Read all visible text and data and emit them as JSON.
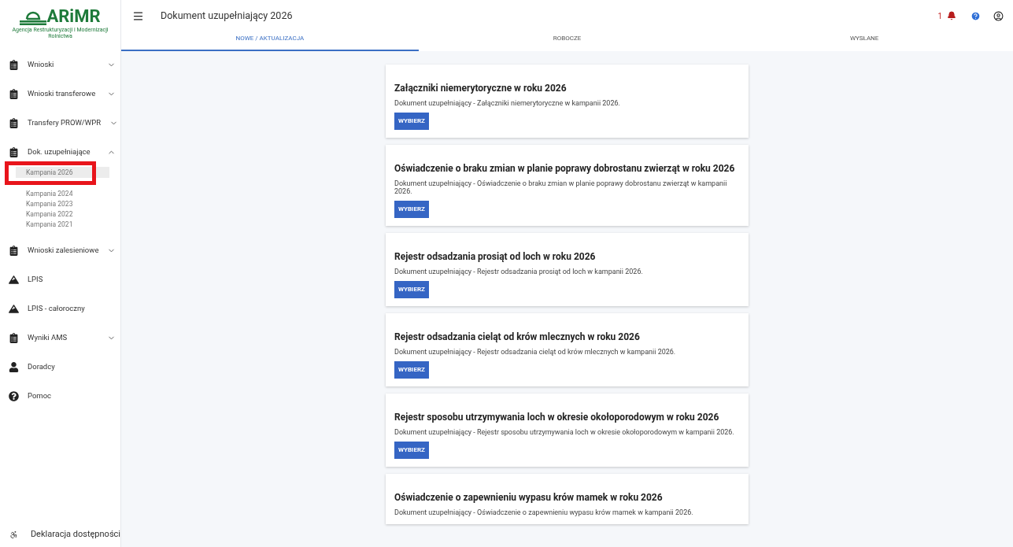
{
  "logo": {
    "name": "ARiMR",
    "subtitle": "Agencja Restrukturyzacji i Modernizacji Rolnictwa"
  },
  "header": {
    "title": "Dokument uzupełniający 2026",
    "notification_count": "1"
  },
  "tabs": [
    {
      "label": "NOWE / AKTUALIZACJA",
      "selected": true
    },
    {
      "label": "ROBOCZE",
      "selected": false
    },
    {
      "label": "WYSŁANE",
      "selected": false
    }
  ],
  "sidebar": {
    "items": [
      {
        "label": "Wnioski",
        "kind": "clipboard",
        "expanded": false
      },
      {
        "label": "Wnioski transferowe",
        "kind": "clipboard",
        "expanded": false
      },
      {
        "label": "Transfery PROW/WPR",
        "kind": "clipboard",
        "expanded": false
      },
      {
        "label": "Dok. uzupełniające",
        "kind": "clipboard",
        "expanded": true,
        "children": [
          {
            "label": "Kampania 2026",
            "selected": true,
            "highlighted": true
          },
          {
            "label": "Kampania 2024",
            "selected": false,
            "highlighted": false
          },
          {
            "label": "Kampania 2023",
            "selected": false,
            "highlighted": false
          },
          {
            "label": "Kampania 2022",
            "selected": false,
            "highlighted": false
          },
          {
            "label": "Kampania 2021",
            "selected": false,
            "highlighted": false
          }
        ]
      },
      {
        "label": "Wnioski zalesieniowe",
        "kind": "clipboard",
        "expanded": false
      },
      {
        "label": "LPIS",
        "kind": "mountains"
      },
      {
        "label": "LPIS - całoroczny",
        "kind": "mountains"
      },
      {
        "label": "Wyniki AMS",
        "kind": "clipboard",
        "expanded": false
      },
      {
        "label": "Doradcy",
        "kind": "person"
      },
      {
        "label": "Pomoc",
        "kind": "help"
      }
    ],
    "footer": {
      "label": "Deklaracja dostępności"
    }
  },
  "cards": [
    {
      "title": "Załączniki niemerytoryczne w roku 2026",
      "description": "Dokument uzupełniający - Załączniki niemerytoryczne w kampanii 2026.",
      "button": "WYBIERZ"
    },
    {
      "title": "Oświadczenie o braku zmian w planie poprawy dobrostanu zwierząt w roku 2026",
      "description": "Dokument uzupełniający - Oświadczenie o braku zmian w planie poprawy dobrostanu zwierząt w kampanii 2026.",
      "button": "WYBIERZ"
    },
    {
      "title": "Rejestr odsadzania prosiąt od loch w roku 2026",
      "description": "Dokument uzupełniający - Rejestr odsadzania prosiąt od loch w kampanii 2026.",
      "button": "WYBIERZ"
    },
    {
      "title": "Rejestr odsadzania cieląt od krów mlecznych w roku 2026",
      "description": "Dokument uzupełniający - Rejestr odsadzania cieląt od krów mlecznych w kampanii 2026.",
      "button": "WYBIERZ"
    },
    {
      "title": "Rejestr sposobu utrzymywania loch w okresie okołoporodowym w roku 2026",
      "description": "Dokument uzupełniający - Rejestr sposobu utrzymywania loch w okresie okołoporodowym w kampanii 2026.",
      "button": "WYBIERZ"
    },
    {
      "title": "Oświadczenie o zapewnieniu wypasu krów mamek w roku 2026",
      "description": "Dokument uzupełniający - Oświadczenie o zapewnieniu wypasu krów mamek w kampanii 2026."
    }
  ]
}
